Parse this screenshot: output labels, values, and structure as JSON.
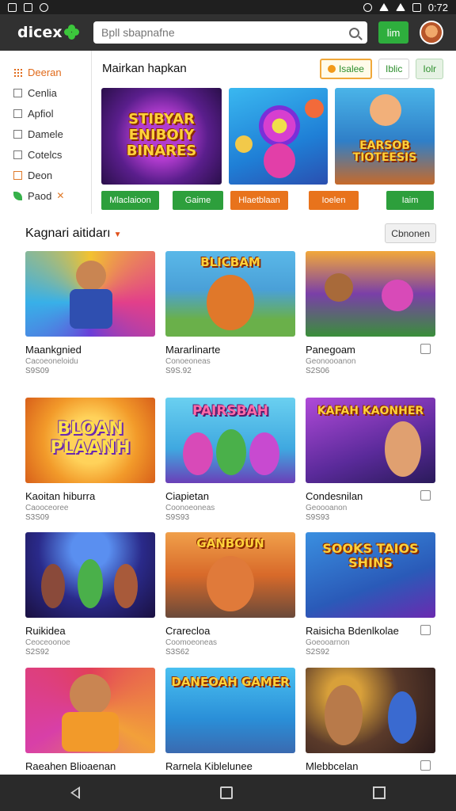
{
  "status_bar": {
    "time": "0:72"
  },
  "header": {
    "logo": "dicex",
    "search_placeholder": "Bpll sbapnafne",
    "action_label": "lim"
  },
  "sidebar": {
    "items": [
      {
        "label": "Deeran",
        "icon": "grid-icon",
        "active": true
      },
      {
        "label": "Cenlia",
        "icon": "checkbox-icon"
      },
      {
        "label": "Apfiol",
        "icon": "checkbox-icon"
      },
      {
        "label": "Damele",
        "icon": "checkbox-icon"
      },
      {
        "label": "Cotelcs",
        "icon": "checkbox-icon"
      },
      {
        "label": "Deon",
        "icon": "checkbox-icon"
      },
      {
        "label": "Paod",
        "icon": "leaf-icon"
      }
    ]
  },
  "featured": {
    "title": "Mairkan hapkan",
    "actions": [
      "Isalee",
      "Iblic",
      "Iolr"
    ],
    "cards": [
      {
        "art_text": "STIBYAR ENIBOIY BINARES",
        "button": "Mlaclaioon",
        "button_color": "green"
      },
      {
        "art_text": "",
        "button": "Gaime",
        "button_color": "green"
      },
      {
        "art_text": "EARSOB TIOTEESIS",
        "button": "Hlaetblaan",
        "button_color": "orange"
      }
    ],
    "extra_buttons": [
      {
        "label": "Ioelen",
        "color": "orange"
      },
      {
        "label": "Iaim",
        "color": "green"
      }
    ]
  },
  "section": {
    "title": "Kagnari aitidarı",
    "button": "Cbnonen"
  },
  "games": [
    {
      "name": "Maankgnied",
      "sub": "Cacoeoneloidu",
      "count": "S9S09",
      "checkbox": false,
      "art_text": ""
    },
    {
      "name": "Mararlinarte",
      "sub": "Conoeoneas",
      "count": "S9S.92",
      "checkbox": false,
      "art_text": "BLICBAM"
    },
    {
      "name": "Panegoam",
      "sub": "Geonoooanon",
      "count": "S2S06",
      "checkbox": true,
      "art_text": ""
    },
    {
      "name": "Kaoitan hiburra",
      "sub": "Caooceoree",
      "count": "S3S09",
      "checkbox": false,
      "art_text": "BLOAN PLAANH"
    },
    {
      "name": "Ciapietan",
      "sub": "Coonoeoneas",
      "count": "S9S93",
      "checkbox": false,
      "art_text": "PAIRSBAH"
    },
    {
      "name": "Condesnilan",
      "sub": "Geoooanon",
      "count": "S9S93",
      "checkbox": true,
      "art_text": "KAFAH KAONHER"
    },
    {
      "name": "Ruikidea",
      "sub": "Ceoceoonoe",
      "count": "S2S92",
      "checkbox": false,
      "art_text": ""
    },
    {
      "name": "Crarecloa",
      "sub": "Coomoeoneas",
      "count": "S3S62",
      "checkbox": false,
      "art_text": "GANBOUN"
    },
    {
      "name": "Raisicha Bdenlkolae",
      "sub": "Goeooarnon",
      "count": "S2S92",
      "checkbox": true,
      "art_text": "SOOKS TAIOS SHINS"
    },
    {
      "name": "Raeahen Blioaenan",
      "sub": "",
      "count": "",
      "checkbox": false,
      "art_text": ""
    },
    {
      "name": "Rarnela Kiblelunee",
      "sub": "",
      "count": "",
      "checkbox": false,
      "art_text": "DANEOAH GAMER"
    },
    {
      "name": "Mlebbcelan",
      "sub": "",
      "count": "",
      "checkbox": true,
      "art_text": ""
    }
  ],
  "colors": {
    "appbar": "#313131",
    "accent_green": "#2d9f3c",
    "accent_orange": "#e8731c"
  }
}
